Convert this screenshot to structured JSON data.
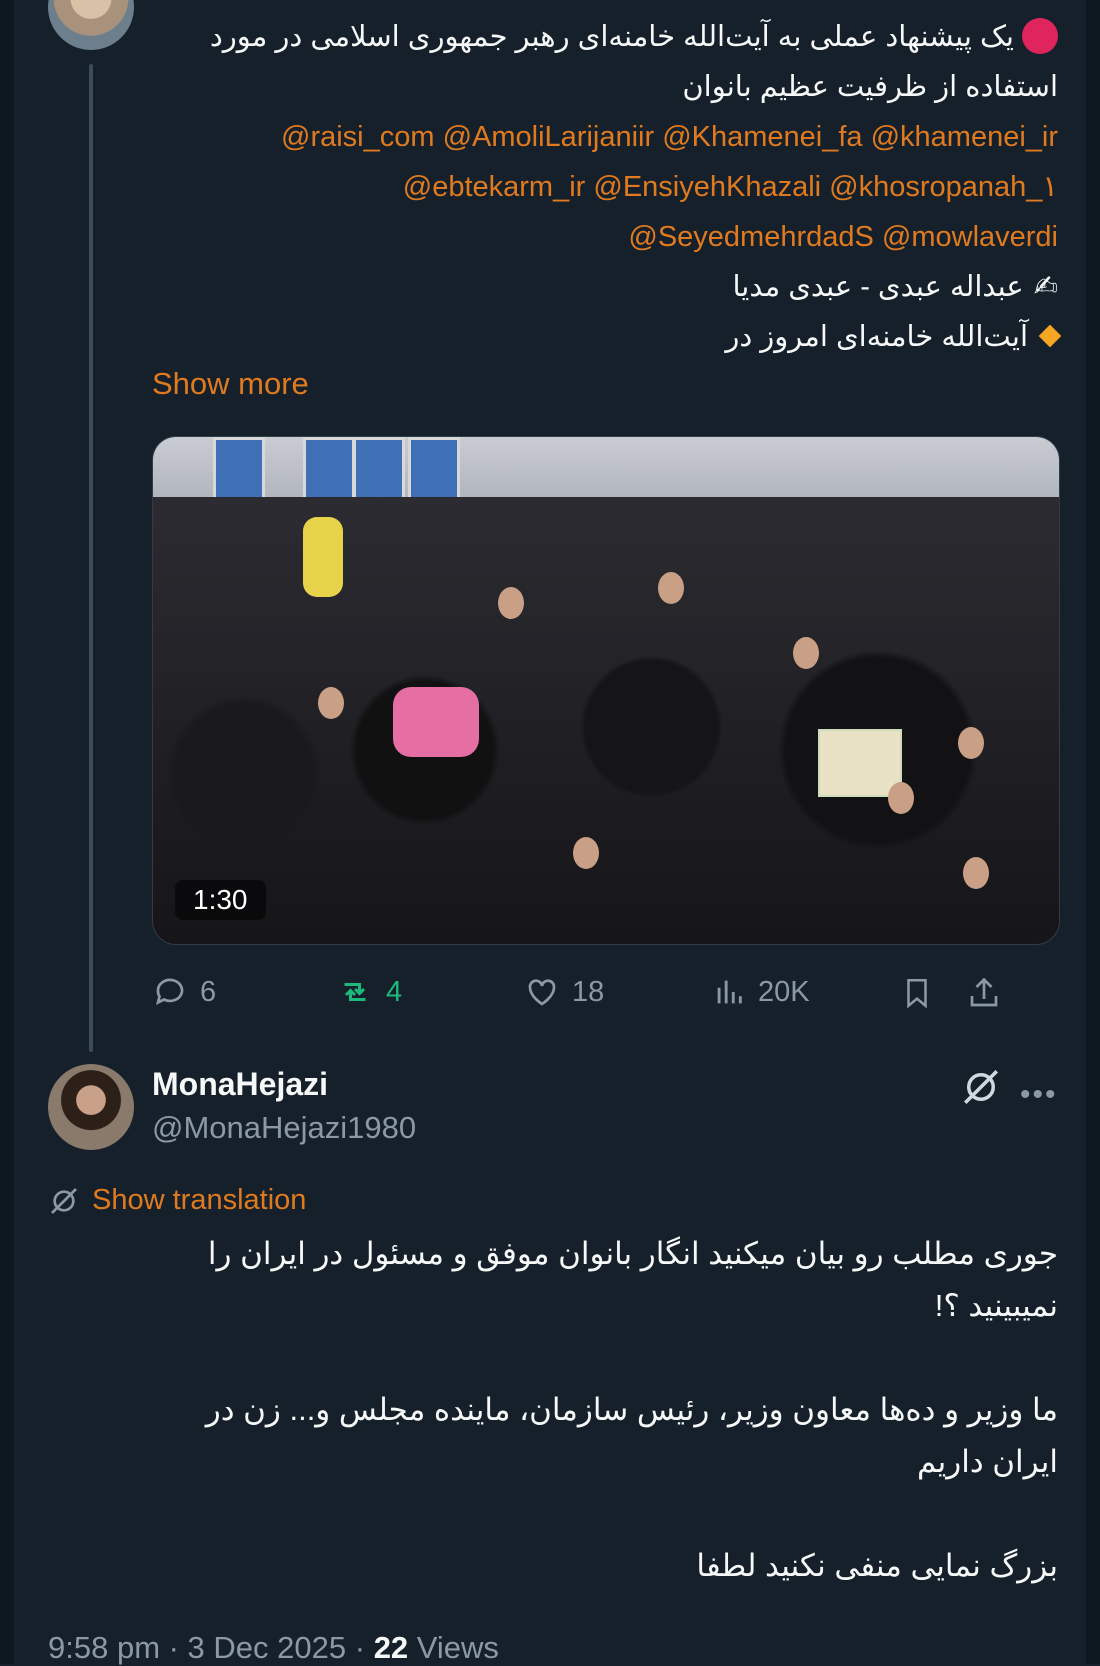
{
  "quoted_tweet": {
    "lines": [
      "یک پیشنهاد عملی به آیت‌الله خامنه‌ای رهبر جمهوری اسلامی در مورد",
      "استفاده از ظرفیت عظیم بانوان"
    ],
    "mention_lines": [
      "@raisi_com @AmoliLarijaniir @Khamenei_fa @khamenei_ir",
      "@ebtekarm_ir @EnsiyehKhazali @khosropanah_١",
      "@SeyedmehrdadS @mowlaverdi"
    ],
    "line_author": "عبداله عبدی - عبدی مدیا",
    "line_last": "آیت‌الله خامنه‌ای امروز در",
    "show_more": "Show more",
    "video_duration": "1:30",
    "reply_count": "6",
    "retweet_count": "4",
    "like_count": "18",
    "view_count": "20K",
    "accent_color": "#e07a1f",
    "retweet_color": "#1db97a"
  },
  "reply": {
    "display_name": "MonaHejazi",
    "handle": "@MonaHejazi1980",
    "show_translation": "Show translation",
    "paragraph1": [
      "جوری مطلب رو بیان میکنید انگار بانوان موفق و مسئول در ایران را",
      "نمیبینید ؟!"
    ],
    "paragraph2": [
      "ما وزیر و ده‌ها معاون وزیر، رئیس سازمان، ماینده مجلس و... زن در",
      "ایران داریم"
    ],
    "paragraph3": "بزرگ نمایی منفی نکنید لطفا",
    "time": "9:58 pm · 3 Dec 2025 ·",
    "views_count": "22",
    "views_label": "Views"
  }
}
